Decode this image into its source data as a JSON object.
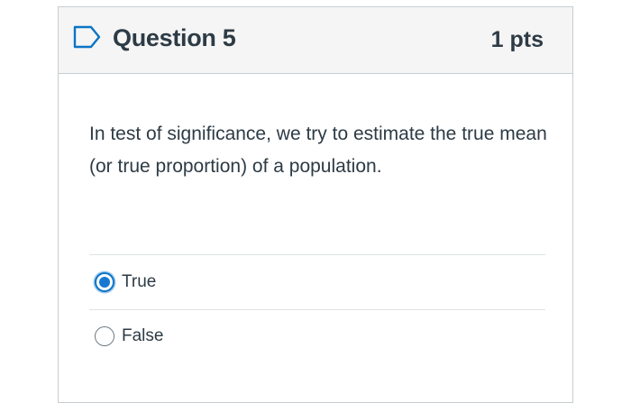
{
  "question": {
    "title": "Question 5",
    "points": "1 pts",
    "text": "In test of significance, we try to estimate the true mean (or true proportion) of a population.",
    "flag_icon": "bookmark-flag-icon"
  },
  "answers": [
    {
      "label": "True",
      "selected": true
    },
    {
      "label": "False",
      "selected": false
    }
  ],
  "colors": {
    "header_bg": "#f5f5f5",
    "border": "#c7cdd1",
    "text": "#2d3b45",
    "accent": "#1778d2"
  }
}
